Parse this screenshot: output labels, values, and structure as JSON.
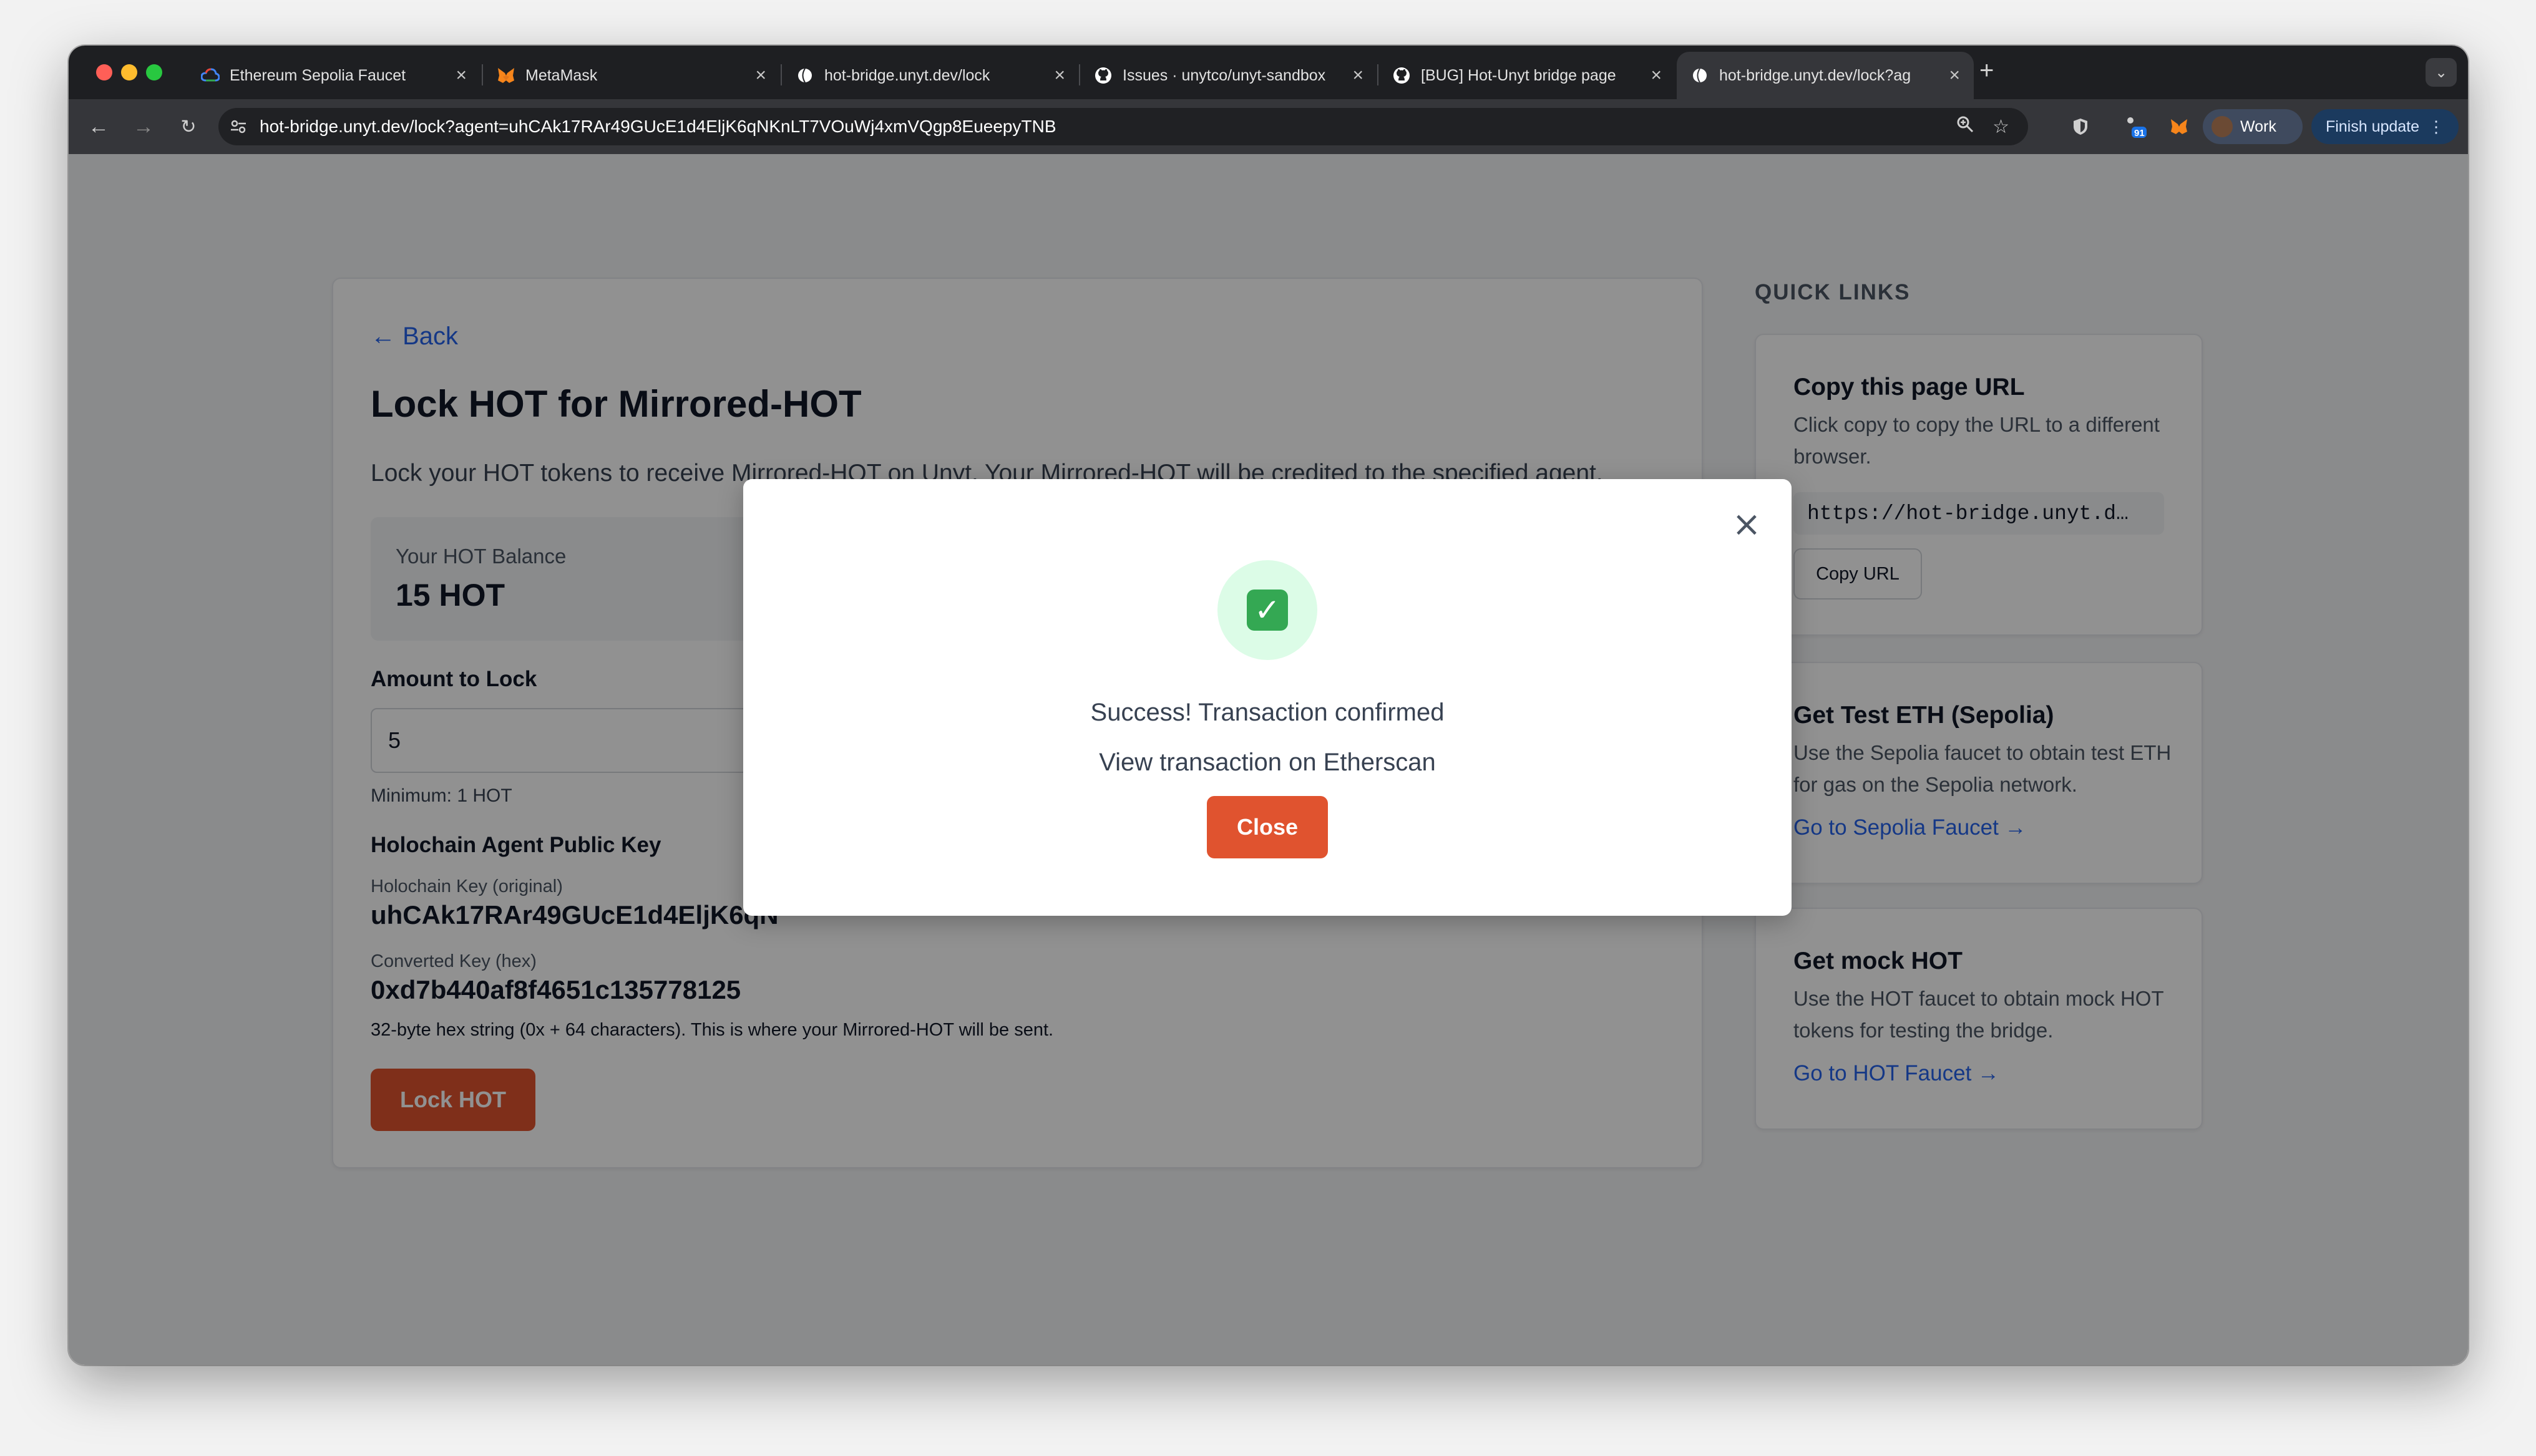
{
  "browser": {
    "tabs": [
      {
        "title": "Ethereum Sepolia Faucet",
        "icon": "google-cloud-icon"
      },
      {
        "title": "MetaMask",
        "icon": "metamask-fox-icon"
      },
      {
        "title": "hot-bridge.unyt.dev/lock",
        "icon": "globe-icon"
      },
      {
        "title": "Issues · unytco/unyt-sandbox",
        "icon": "github-icon"
      },
      {
        "title": "[BUG] Hot-Unyt bridge page",
        "icon": "github-icon"
      },
      {
        "title": "hot-bridge.unyt.dev/lock?ag",
        "icon": "globe-icon"
      }
    ],
    "url": "hot-bridge.unyt.dev/lock?agent=uhCAk17RAr49GUcE1d4EljK6qNKnLT7VOuWj4xmVQgp8EueepyTNB",
    "extension_badge": "91",
    "profile_label": "Work",
    "update_label": "Finish update"
  },
  "page": {
    "back_label": "← Back",
    "title": "Lock HOT for Mirrored-HOT",
    "description": "Lock your HOT tokens to receive Mirrored-HOT on Unyt. Your Mirrored-HOT will be credited to the specified agent.",
    "balance_label": "Your HOT Balance",
    "balance_value": "15 HOT",
    "amount_label": "Amount to Lock",
    "amount_value": "5",
    "minimum_text": "Minimum: 1 HOT",
    "agent_heading": "Holochain Agent Public Key",
    "original_key_label": "Holochain Key (original)",
    "original_key_value": "uhCAk17RAr49GUcE1d4EljK6qN",
    "converted_key_label": "Converted Key (hex)",
    "converted_key_value": "0xd7b440af8f4651c135778125",
    "hint": "32-byte hex string (0x + 64 characters). This is where your Mirrored-HOT will be sent.",
    "lock_button": "Lock HOT"
  },
  "quick_links": {
    "title": "QUICK LINKS",
    "copy_card": {
      "title": "Copy this page URL",
      "desc": "Click copy to copy the URL to a different browser.",
      "url_value": "https://hot-bridge.unyt.d…",
      "button": "Copy URL"
    },
    "eth_card": {
      "title": "Get Test ETH (Sepolia)",
      "desc": "Use the Sepolia faucet to obtain test ETH for gas on the Sepolia network.",
      "link": "Go to Sepolia Faucet →"
    },
    "hot_card": {
      "title": "Get mock HOT",
      "desc": "Use the HOT faucet to obtain mock HOT tokens for testing the bridge.",
      "link": "Go to HOT Faucet →"
    }
  },
  "modal": {
    "icon": "check-mark-icon",
    "title": "Success! Transaction confirmed",
    "link_text": "View transaction on Etherscan",
    "close_button": "Close"
  },
  "colors": {
    "accent": "#e0532f",
    "link": "#2563eb",
    "success": "#34a853"
  }
}
